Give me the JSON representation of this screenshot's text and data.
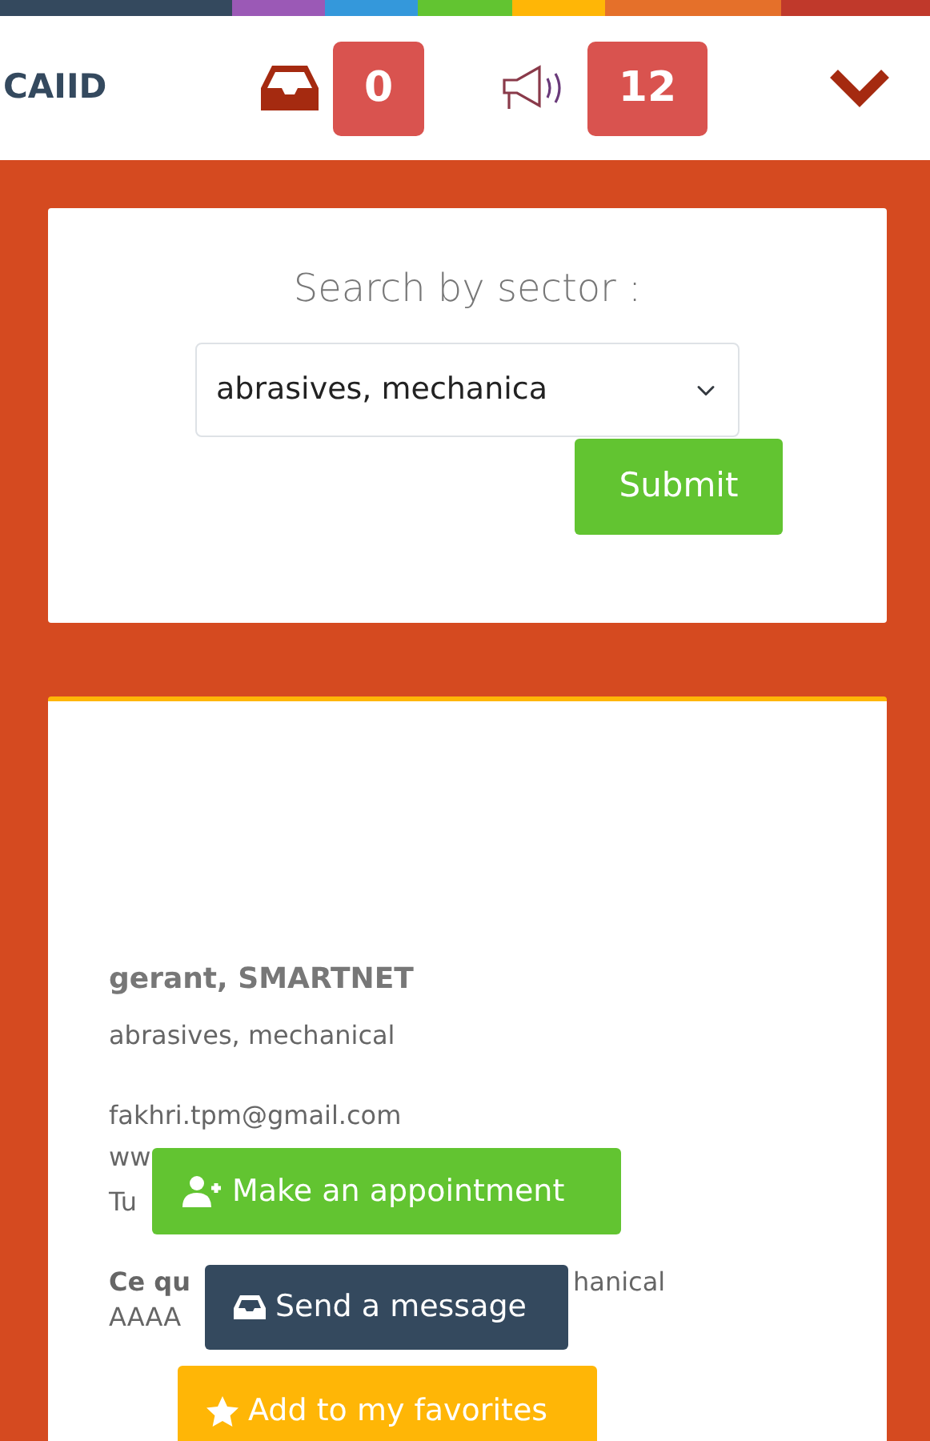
{
  "stripe": [
    {
      "color": "#34495e"
    },
    {
      "color": "#9b59b6"
    },
    {
      "color": "#3498db"
    },
    {
      "color": "#62c431"
    },
    {
      "color": "#ffb606"
    },
    {
      "color": "#e5702a"
    },
    {
      "color": "#c0392b"
    }
  ],
  "header": {
    "brand": "CAIID",
    "messages_count": "0",
    "notifications_count": "12"
  },
  "search": {
    "label": "Search by sector :",
    "selected_sector": "abrasives, mechanica",
    "submit": "Submit"
  },
  "profile": {
    "name": "gerant, SMARTNET",
    "sector": "abrasives, mechanical",
    "email": "fakhri.tpm@gmail.com",
    "website_fragment": "ww",
    "country_fragment": "Tu",
    "question_fragment": "Ce qu",
    "answer_fragment": "hanical",
    "answer_line_2": "AAAA",
    "actions": [
      {
        "kind": "appointment",
        "label": "Make an appointment"
      },
      {
        "kind": "message",
        "label": "Send a message"
      },
      {
        "kind": "favorite",
        "label": "Add to my favorites"
      }
    ]
  }
}
